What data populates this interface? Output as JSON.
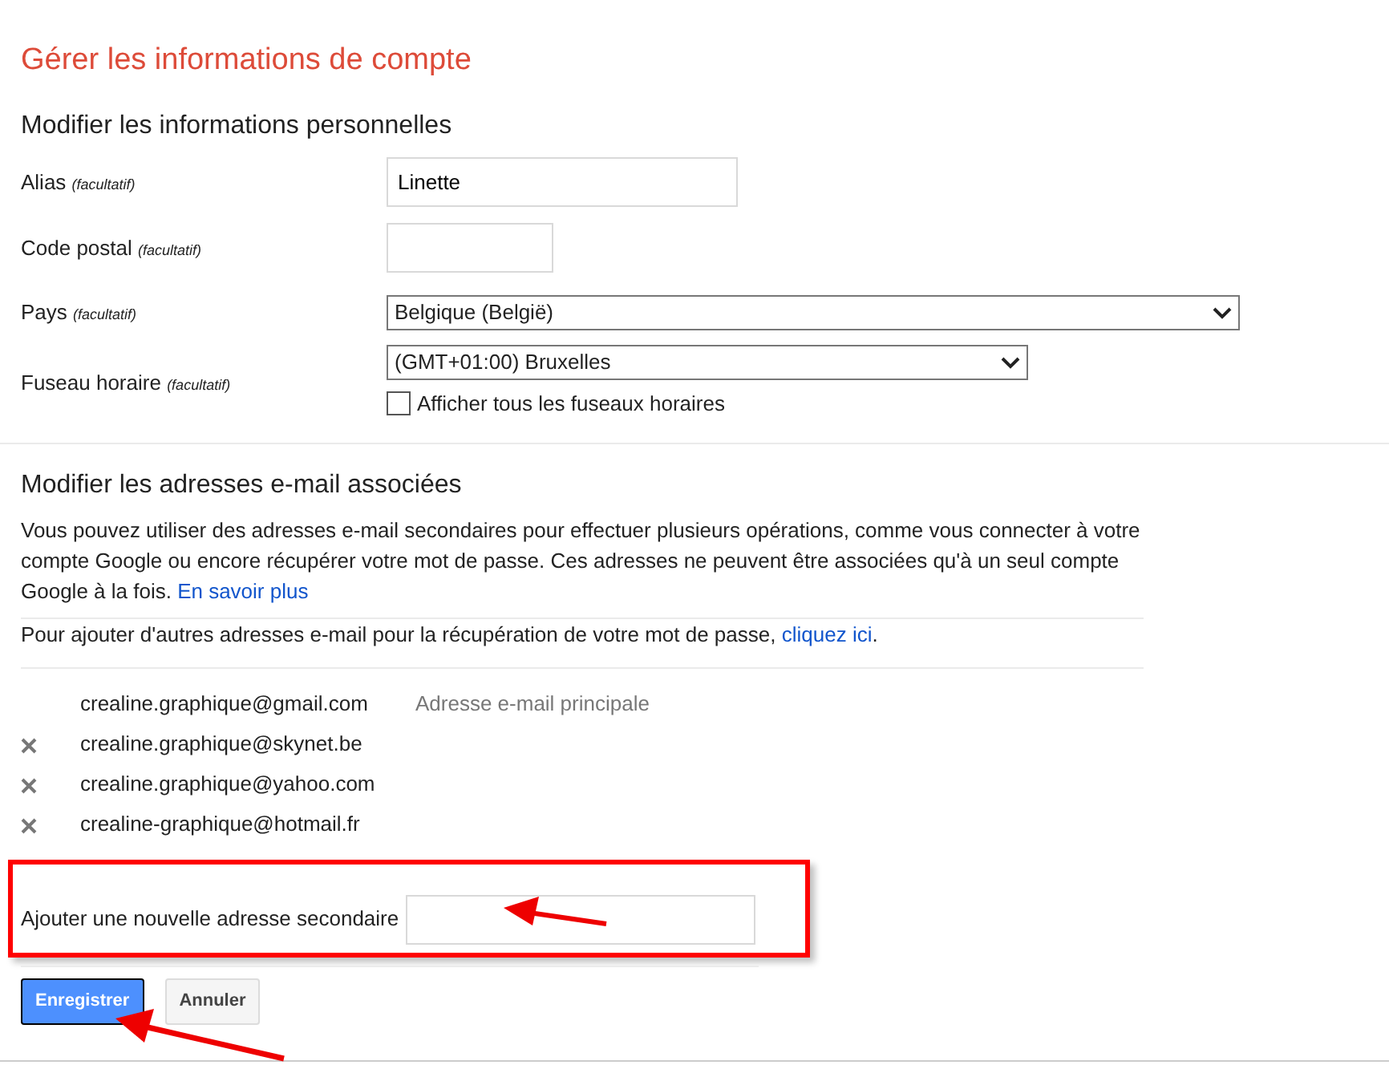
{
  "title": "Gérer les informations de compte",
  "personal": {
    "heading": "Modifier les informations personnelles",
    "fields": [
      {
        "kind": "text",
        "label": "Alias",
        "optional": "(facultatif)",
        "value": "Linette"
      },
      {
        "kind": "text",
        "label": "Code postal",
        "optional": "(facultatif)"
      },
      {
        "kind": "select",
        "label": "Pays",
        "optional": "(facultatif)",
        "value": "Belgique (België)"
      },
      {
        "kind": "select",
        "label": "Fuseau horaire",
        "optional": "(facultatif)",
        "value": "(GMT+01:00) Bruxelles",
        "checkbox": {
          "label": "Afficher tous les fuseaux horaires",
          "checked": false
        }
      }
    ]
  },
  "emails": {
    "heading": "Modifier les adresses e-mail associées",
    "intro": "Vous pouvez utiliser des adresses e-mail secondaires pour effectuer plusieurs opérations, comme vous connecter à votre compte Google ou encore récupérer votre mot de passe. Ces adresses ne peuvent être associées qu'à un seul compte Google à la fois.",
    "intro_link": "En savoir plus",
    "recovery": "Pour ajouter d'autres adresses e-mail pour la récupération de votre mot de passe,",
    "recovery_link": "cliquez ici",
    "recovery_end": ".",
    "addresses": [
      {
        "address": "crealine.graphique@gmail.com",
        "removable": false,
        "note": "Adresse e-mail principale"
      },
      {
        "address": "crealine.graphique@skynet.be",
        "removable": true
      },
      {
        "address": "crealine.graphique@yahoo.com",
        "removable": true
      },
      {
        "address": "crealine-graphique@hotmail.fr",
        "removable": true
      }
    ],
    "add_label": "Ajouter une nouvelle adresse secondaire"
  },
  "buttons": [
    {
      "label": "Enregistrer",
      "kind": "primary"
    },
    {
      "label": "Annuler",
      "kind": "secondary"
    }
  ]
}
